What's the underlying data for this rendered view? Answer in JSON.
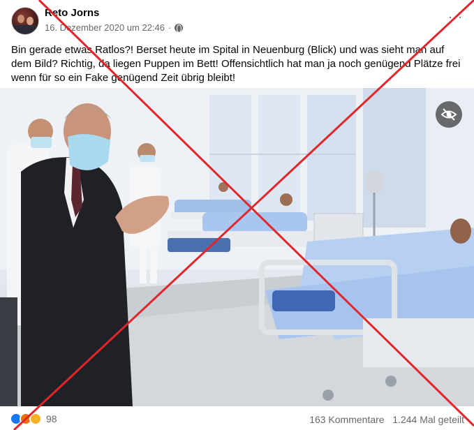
{
  "post": {
    "author": "Reto Jorns",
    "date": "16. Dezember 2020 um 22:46",
    "separator": "·",
    "more_label": "···",
    "text": "Bin gerade etwas Ratlos?! Berset heute im Spital in Neuenburg (Blick) und was sieht man auf dem Bild? Richtig, da liegen Puppen im Bett! Offensichtlich hat man ja noch genügend Plätze frei wenn für so ein Fake genügend Zeit übrig bleibt!"
  },
  "photo": {
    "overlay_icon": "eye-slash-icon"
  },
  "footer": {
    "reaction_icons": [
      "like-icon",
      "angry-icon",
      "haha-icon"
    ],
    "reaction_count": "98",
    "comments": "163 Kommentare",
    "shares": "1.244 Mal geteilt"
  },
  "colors": {
    "cross": "#e0262b",
    "facebook_blue": "#1877f2",
    "meta_gray": "#65676b"
  }
}
